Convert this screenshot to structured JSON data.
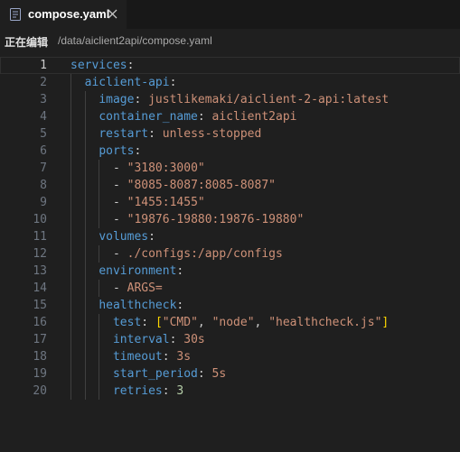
{
  "tab": {
    "title": "compose.yaml",
    "icon": "file-text-icon",
    "close_icon": "close-icon"
  },
  "path_bar": {
    "status": "正在编辑",
    "path": "/data/aiclient2api/compose.yaml"
  },
  "colors": {
    "background": "#1f1f1f",
    "key": "#569cd6",
    "string": "#ce9178",
    "number": "#b5cea8",
    "bracket": "#ffd700",
    "line_number": "#6e7681"
  },
  "editor": {
    "current_line": 1,
    "lines": [
      {
        "n": "1",
        "indent": 0,
        "tokens": [
          {
            "t": "services",
            "c": "key"
          },
          {
            "t": ":",
            "c": "punc"
          }
        ]
      },
      {
        "n": "2",
        "indent": 1,
        "tokens": [
          {
            "t": "aiclient-api",
            "c": "key"
          },
          {
            "t": ":",
            "c": "punc"
          }
        ]
      },
      {
        "n": "3",
        "indent": 2,
        "tokens": [
          {
            "t": "image",
            "c": "key"
          },
          {
            "t": ": ",
            "c": "punc"
          },
          {
            "t": "justlikemaki/aiclient-2-api:latest",
            "c": "str"
          }
        ]
      },
      {
        "n": "4",
        "indent": 2,
        "tokens": [
          {
            "t": "container_name",
            "c": "key"
          },
          {
            "t": ": ",
            "c": "punc"
          },
          {
            "t": "aiclient2api",
            "c": "str"
          }
        ]
      },
      {
        "n": "5",
        "indent": 2,
        "tokens": [
          {
            "t": "restart",
            "c": "key"
          },
          {
            "t": ": ",
            "c": "punc"
          },
          {
            "t": "unless-stopped",
            "c": "str"
          }
        ]
      },
      {
        "n": "6",
        "indent": 2,
        "tokens": [
          {
            "t": "ports",
            "c": "key"
          },
          {
            "t": ":",
            "c": "punc"
          }
        ]
      },
      {
        "n": "7",
        "indent": 3,
        "tokens": [
          {
            "t": "- ",
            "c": "punc"
          },
          {
            "t": "\"3180:3000\"",
            "c": "str"
          }
        ]
      },
      {
        "n": "8",
        "indent": 3,
        "tokens": [
          {
            "t": "- ",
            "c": "punc"
          },
          {
            "t": "\"8085-8087:8085-8087\"",
            "c": "str"
          }
        ]
      },
      {
        "n": "9",
        "indent": 3,
        "tokens": [
          {
            "t": "- ",
            "c": "punc"
          },
          {
            "t": "\"1455:1455\"",
            "c": "str"
          }
        ]
      },
      {
        "n": "10",
        "indent": 3,
        "tokens": [
          {
            "t": "- ",
            "c": "punc"
          },
          {
            "t": "\"19876-19880:19876-19880\"",
            "c": "str"
          }
        ]
      },
      {
        "n": "11",
        "indent": 2,
        "tokens": [
          {
            "t": "volumes",
            "c": "key"
          },
          {
            "t": ":",
            "c": "punc"
          }
        ]
      },
      {
        "n": "12",
        "indent": 3,
        "tokens": [
          {
            "t": "- ",
            "c": "punc"
          },
          {
            "t": "./configs:/app/configs",
            "c": "str"
          }
        ]
      },
      {
        "n": "13",
        "indent": 2,
        "tokens": [
          {
            "t": "environment",
            "c": "key"
          },
          {
            "t": ":",
            "c": "punc"
          }
        ]
      },
      {
        "n": "14",
        "indent": 3,
        "tokens": [
          {
            "t": "- ",
            "c": "punc"
          },
          {
            "t": "ARGS=",
            "c": "str"
          }
        ]
      },
      {
        "n": "15",
        "indent": 2,
        "tokens": [
          {
            "t": "healthcheck",
            "c": "key"
          },
          {
            "t": ":",
            "c": "punc"
          }
        ]
      },
      {
        "n": "16",
        "indent": 3,
        "tokens": [
          {
            "t": "test",
            "c": "key"
          },
          {
            "t": ": ",
            "c": "punc"
          },
          {
            "t": "[",
            "c": "bracket"
          },
          {
            "t": "\"CMD\"",
            "c": "str"
          },
          {
            "t": ", ",
            "c": "punc"
          },
          {
            "t": "\"node\"",
            "c": "str"
          },
          {
            "t": ", ",
            "c": "punc"
          },
          {
            "t": "\"healthcheck.js\"",
            "c": "str"
          },
          {
            "t": "]",
            "c": "bracket"
          }
        ]
      },
      {
        "n": "17",
        "indent": 3,
        "tokens": [
          {
            "t": "interval",
            "c": "key"
          },
          {
            "t": ": ",
            "c": "punc"
          },
          {
            "t": "30s",
            "c": "str"
          }
        ]
      },
      {
        "n": "18",
        "indent": 3,
        "tokens": [
          {
            "t": "timeout",
            "c": "key"
          },
          {
            "t": ": ",
            "c": "punc"
          },
          {
            "t": "3s",
            "c": "str"
          }
        ]
      },
      {
        "n": "19",
        "indent": 3,
        "tokens": [
          {
            "t": "start_period",
            "c": "key"
          },
          {
            "t": ": ",
            "c": "punc"
          },
          {
            "t": "5s",
            "c": "str"
          }
        ]
      },
      {
        "n": "20",
        "indent": 3,
        "tokens": [
          {
            "t": "retries",
            "c": "key"
          },
          {
            "t": ": ",
            "c": "punc"
          },
          {
            "t": "3",
            "c": "num"
          }
        ]
      }
    ]
  }
}
